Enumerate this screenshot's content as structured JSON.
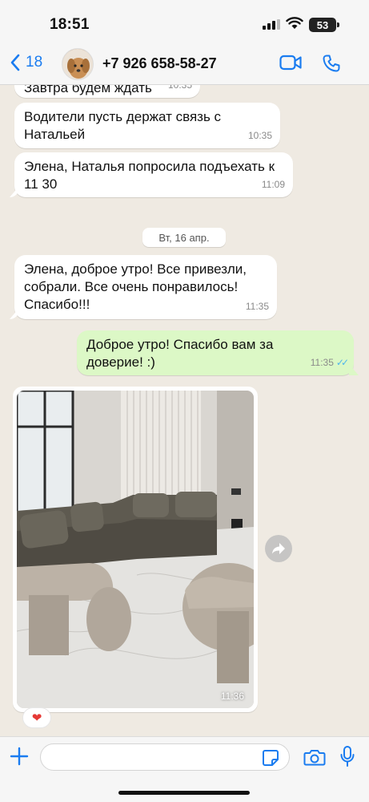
{
  "status_bar": {
    "time": "18:51",
    "battery": "53"
  },
  "header": {
    "back_count": "18",
    "contact_name": "+7 926 658-58-27"
  },
  "messages": [
    {
      "text": "Завтра будем ждать",
      "time": "10:35"
    },
    {
      "text": "Водители пусть держат связь с\nНатальей",
      "time": "10:35"
    },
    {
      "text": "Элена, Наталья попросила подъехать к\n11 30",
      "time": "11:09"
    },
    {
      "text": "Элена, доброе утро! Все привезли,\nсобрали. Все очень понравилось!\nСпасибо!!!",
      "time": "11:35"
    },
    {
      "text": "Доброе утро! Спасибо вам за\nдоверие! :)",
      "time": "11:35",
      "status": "read"
    }
  ],
  "date_separator": "Вт, 16 апр.",
  "photo_message": {
    "time": "11:36",
    "reaction": "❤"
  },
  "input": {
    "placeholder": ""
  },
  "colors": {
    "accent": "#1a7cf0",
    "outgoing_bubble": "#dcf8c6",
    "incoming_bubble": "#ffffff",
    "background": "#efeae2"
  },
  "icons": [
    "back-chevron-icon",
    "video-call-icon",
    "phone-icon",
    "forward-icon",
    "plus-icon",
    "sticker-icon",
    "camera-icon",
    "microphone-icon"
  ]
}
